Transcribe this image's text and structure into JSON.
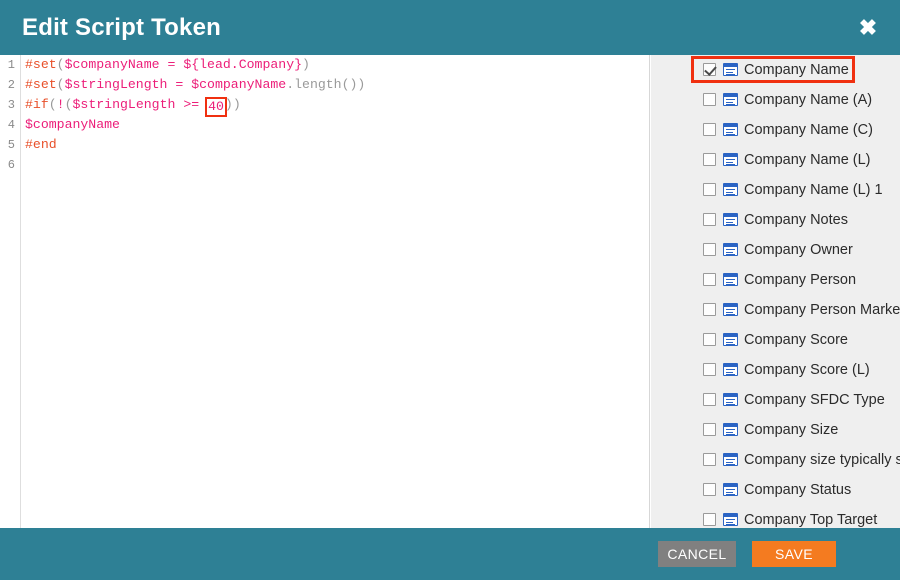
{
  "header": {
    "title": "Edit Script Token",
    "close_icon": "close-icon",
    "close_glyph": "✖",
    "background": "#2e8095"
  },
  "editor": {
    "line_numbers": [
      "1",
      "2",
      "3",
      "4",
      "5",
      "6"
    ],
    "lines": [
      {
        "number": "1",
        "tokens": [
          {
            "t": "#set",
            "c": "directive"
          },
          {
            "t": "(",
            "c": "punct"
          },
          {
            "t": "$companyName",
            "c": "var"
          },
          {
            "t": " ",
            "c": "plain"
          },
          {
            "t": "=",
            "c": "op"
          },
          {
            "t": " ",
            "c": "plain"
          },
          {
            "t": "${lead.Company}",
            "c": "var"
          },
          {
            "t": ")",
            "c": "punct"
          }
        ]
      },
      {
        "number": "2",
        "tokens": [
          {
            "t": "#set",
            "c": "directive"
          },
          {
            "t": "(",
            "c": "punct"
          },
          {
            "t": "$stringLength",
            "c": "var"
          },
          {
            "t": " ",
            "c": "plain"
          },
          {
            "t": "=",
            "c": "op"
          },
          {
            "t": " ",
            "c": "plain"
          },
          {
            "t": "$companyName",
            "c": "var"
          },
          {
            "t": ".length",
            "c": "punct"
          },
          {
            "t": "())",
            "c": "punct"
          }
        ]
      },
      {
        "number": "3",
        "tokens": [
          {
            "t": "#if",
            "c": "directive"
          },
          {
            "t": "(",
            "c": "punct"
          },
          {
            "t": "!",
            "c": "op"
          },
          {
            "t": "(",
            "c": "punct"
          },
          {
            "t": "$stringLength",
            "c": "var"
          },
          {
            "t": " ",
            "c": "plain"
          },
          {
            "t": ">=",
            "c": "op"
          },
          {
            "t": " ",
            "c": "plain"
          },
          {
            "t": "40",
            "c": "num",
            "annotated": true
          },
          {
            "t": "))",
            "c": "punct"
          }
        ]
      },
      {
        "number": "4",
        "tokens": [
          {
            "t": "$companyName",
            "c": "var"
          }
        ]
      },
      {
        "number": "5",
        "tokens": [
          {
            "t": "#end",
            "c": "directive"
          }
        ]
      },
      {
        "number": "6",
        "tokens": []
      }
    ],
    "highlight_annotation_value": "40",
    "annotation_color": "#f03010"
  },
  "field_panel": {
    "items": [
      {
        "label": "Company Name",
        "checked": true,
        "annotated": true,
        "icon": "field-icon"
      },
      {
        "label": "Company Name (A)",
        "checked": false,
        "annotated": false,
        "icon": "field-icon"
      },
      {
        "label": "Company Name (C)",
        "checked": false,
        "annotated": false,
        "icon": "field-icon"
      },
      {
        "label": "Company Name (L)",
        "checked": false,
        "annotated": false,
        "icon": "field-icon"
      },
      {
        "label": "Company Name (L) 1",
        "checked": false,
        "annotated": false,
        "icon": "field-icon"
      },
      {
        "label": "Company Notes",
        "checked": false,
        "annotated": false,
        "icon": "field-icon"
      },
      {
        "label": "Company Owner",
        "checked": false,
        "annotated": false,
        "icon": "field-icon"
      },
      {
        "label": "Company Person",
        "checked": false,
        "annotated": false,
        "icon": "field-icon"
      },
      {
        "label": "Company Person Marketable",
        "checked": false,
        "annotated": false,
        "icon": "field-icon"
      },
      {
        "label": "Company Score",
        "checked": false,
        "annotated": false,
        "icon": "field-icon"
      },
      {
        "label": "Company Score (L)",
        "checked": false,
        "annotated": false,
        "icon": "field-icon"
      },
      {
        "label": "Company SFDC Type",
        "checked": false,
        "annotated": false,
        "icon": "field-icon"
      },
      {
        "label": "Company Size",
        "checked": false,
        "annotated": false,
        "icon": "field-icon"
      },
      {
        "label": "Company size typically sells to",
        "checked": false,
        "annotated": false,
        "icon": "field-icon"
      },
      {
        "label": "Company Status",
        "checked": false,
        "annotated": false,
        "icon": "field-icon"
      },
      {
        "label": "Company Top Target",
        "checked": false,
        "annotated": false,
        "icon": "field-icon"
      }
    ]
  },
  "footer": {
    "cancel_label": "CANCEL",
    "save_label": "SAVE",
    "cancel_color": "#808080",
    "save_color": "#f47b20",
    "background": "#2e8095"
  }
}
